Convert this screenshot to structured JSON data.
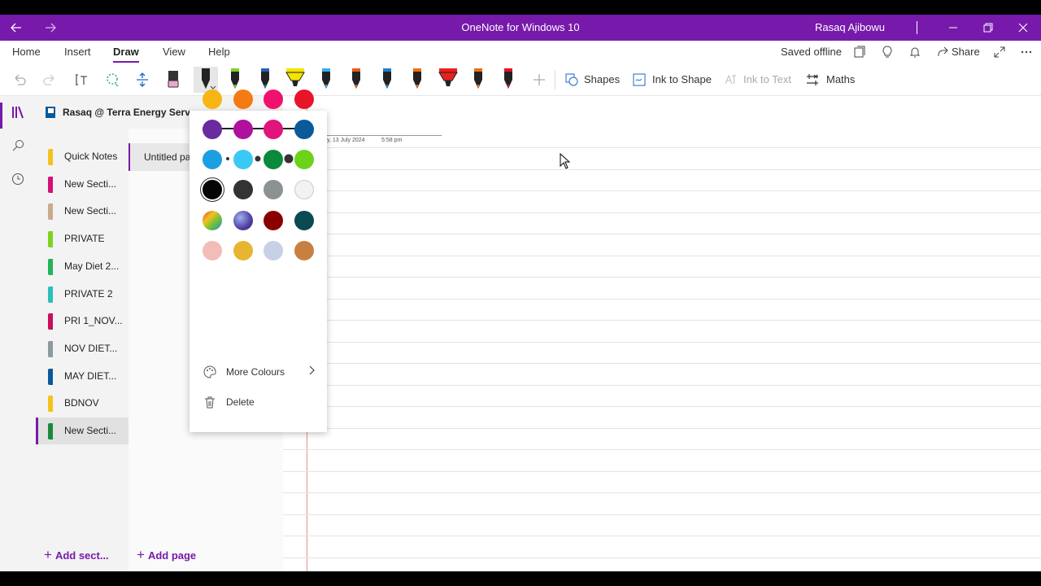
{
  "titlebar": {
    "title": "OneNote for Windows 10",
    "user": "Rasaq Ajibowu",
    "back_icon": "arrow-left-icon",
    "forward_icon": "arrow-right-icon",
    "bg_color": "#7719aa"
  },
  "menu": {
    "items": [
      "Home",
      "Insert",
      "Draw",
      "View",
      "Help"
    ],
    "active": "Draw",
    "saved_status": "Saved offline",
    "share_label": "Share"
  },
  "toolbar": {
    "shapes_label": "Shapes",
    "ink_to_shape_label": "Ink to Shape",
    "ink_to_text_label": "Ink to Text",
    "maths_label": "Maths",
    "pens": [
      {
        "color": "#e84fa0",
        "kind": "eraser"
      },
      {
        "color": "#222222",
        "kind": "pen",
        "selected": true
      },
      {
        "color": "#7fd321",
        "kind": "pen"
      },
      {
        "color": "#2a5fb8",
        "kind": "pen"
      },
      {
        "color": "#f5e400",
        "kind": "highlighter"
      },
      {
        "color": "#31b0f0",
        "kind": "pen"
      },
      {
        "color": "#e85a1a",
        "kind": "pen"
      },
      {
        "color": "#1b7fd0",
        "kind": "pen"
      },
      {
        "color": "#f07010",
        "kind": "pen"
      },
      {
        "color": "#e82020",
        "kind": "highlighter"
      },
      {
        "color": "#f07010",
        "kind": "pen"
      },
      {
        "color": "#e8102a",
        "kind": "pen"
      }
    ]
  },
  "notebook": {
    "title": "Rasaq @ Terra Energy Servic"
  },
  "sections": [
    {
      "label": "Quick Notes",
      "color": "#f4c21b"
    },
    {
      "label": "New Secti...",
      "color": "#d4107a"
    },
    {
      "label": "New Secti...",
      "color": "#c8ab8f"
    },
    {
      "label": "PRIVATE",
      "color": "#7fd321"
    },
    {
      "label": "May Diet 2...",
      "color": "#24b25a"
    },
    {
      "label": "PRIVATE 2",
      "color": "#2bc0b8"
    },
    {
      "label": "PRI 1_NOV...",
      "color": "#c8105a"
    },
    {
      "label": "NOV DIET...",
      "color": "#8c9a9f"
    },
    {
      "label": "MAY DIET...",
      "color": "#0a5a9a"
    },
    {
      "label": "BDNOV",
      "color": "#f4c21b"
    },
    {
      "label": "New Secti...",
      "color": "#1a8a3a",
      "selected": true
    }
  ],
  "add_section_label": "Add sect...",
  "pages": [
    {
      "label": "Untitled pa"
    }
  ],
  "add_page_label": "Add page",
  "page": {
    "date": "y, 13 July 2024",
    "time": "5:58 pm"
  },
  "color_panel": {
    "swatches": [
      [
        "#f7b516",
        "#f47a14",
        "#f0116e",
        "#e8142a"
      ],
      [
        "#6a2aa0",
        "#b0109e",
        "#e0147a",
        "#0a5a9a"
      ],
      [
        "#1aa0e0",
        "#3cc8f4",
        "#0a8a3a",
        "#6cd21a"
      ],
      [
        "#050505",
        "#333333",
        "#8c9294",
        "#f2f2f2"
      ],
      [
        "rainbow",
        "galaxy",
        "#8a0000",
        "#0a4a50"
      ],
      [
        "#f2bdb6",
        "#e8b530",
        "#c8d0e6",
        "#c88040"
      ]
    ],
    "selected": [
      3,
      0
    ],
    "more_colours_label": "More Colours",
    "delete_label": "Delete"
  }
}
